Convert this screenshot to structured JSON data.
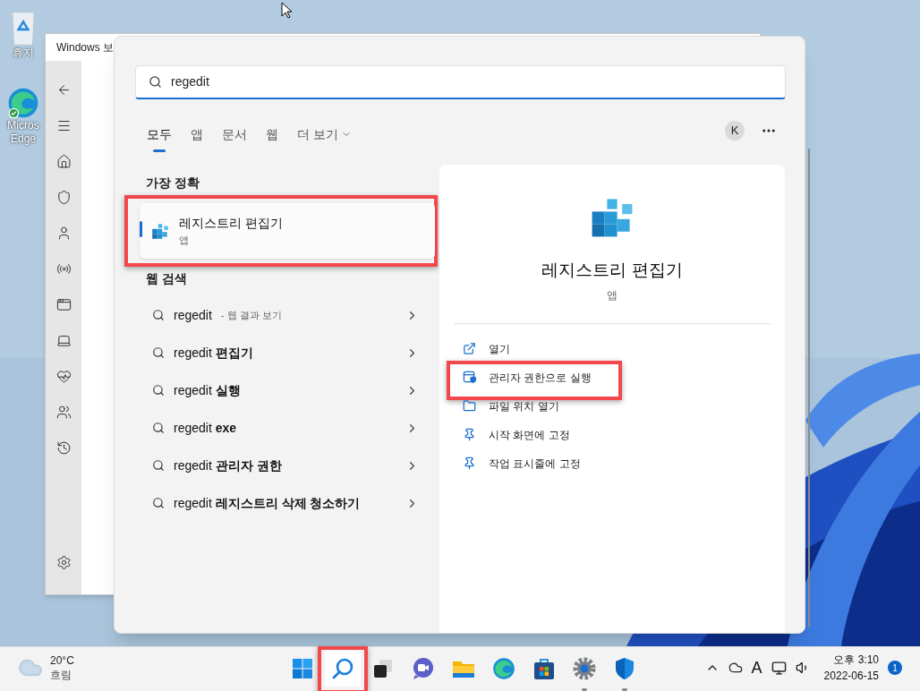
{
  "desktop_icons": [
    {
      "kind": "recycle-bin",
      "label_lines": [
        "휴지"
      ]
    },
    {
      "kind": "edge",
      "label_lines": [
        "Micros",
        "Edge"
      ]
    }
  ],
  "background_window": {
    "title": "Windows 보"
  },
  "search": {
    "query": "regedit",
    "tabs": [
      {
        "label": "모두",
        "selected": true
      },
      {
        "label": "앱",
        "selected": false
      },
      {
        "label": "문서",
        "selected": false
      },
      {
        "label": "웹",
        "selected": false
      },
      {
        "label": "더 보기",
        "selected": false
      }
    ],
    "avatar": "K",
    "best_match": {
      "heading": "가장 정확",
      "title": "레지스트리 편집기",
      "subtitle": "앱",
      "selected": true,
      "highlighted": true
    },
    "web": {
      "heading": "웹 검색",
      "items": [
        {
          "text": "regedit",
          "note": "- 웹 결과 보기"
        },
        {
          "text": "regedit **편집기**"
        },
        {
          "text": "regedit **실행**"
        },
        {
          "text": "regedit **exe**"
        },
        {
          "text": "regedit **관리자 권한**"
        },
        {
          "text": "regedit **레지스트리 삭제 청소하기**"
        }
      ]
    },
    "detail": {
      "title": "레지스트리 편집기",
      "subtitle": "앱",
      "actions": [
        {
          "kind": "open",
          "label": "열기",
          "highlighted": false
        },
        {
          "kind": "admin",
          "label": "관리자 권한으로 실행",
          "highlighted": true
        },
        {
          "kind": "folder",
          "label": "파일 위치 열기",
          "highlighted": false
        },
        {
          "kind": "pin",
          "label": "시작 화면에 고정",
          "highlighted": false
        },
        {
          "kind": "pin",
          "label": "작업 표시줄에 고정",
          "highlighted": false
        }
      ]
    }
  },
  "taskbar": {
    "weather": {
      "temperature": "20°C",
      "condition": "흐림"
    },
    "apps": [
      {
        "kind": "start",
        "running": false,
        "highlighted": false
      },
      {
        "kind": "search",
        "running": false,
        "highlighted": true
      },
      {
        "kind": "task-view",
        "running": false,
        "highlighted": false
      },
      {
        "kind": "chat",
        "running": false,
        "highlighted": false
      },
      {
        "kind": "explorer",
        "running": false,
        "highlighted": false
      },
      {
        "kind": "edge",
        "running": false,
        "highlighted": false
      },
      {
        "kind": "store",
        "running": false,
        "highlighted": false
      },
      {
        "kind": "settings",
        "running": true,
        "highlighted": false
      },
      {
        "kind": "security",
        "running": true,
        "highlighted": false
      }
    ],
    "input_indicator": "A",
    "time": "오후 3:10",
    "date": "2022-06-15",
    "notifications": "1"
  }
}
